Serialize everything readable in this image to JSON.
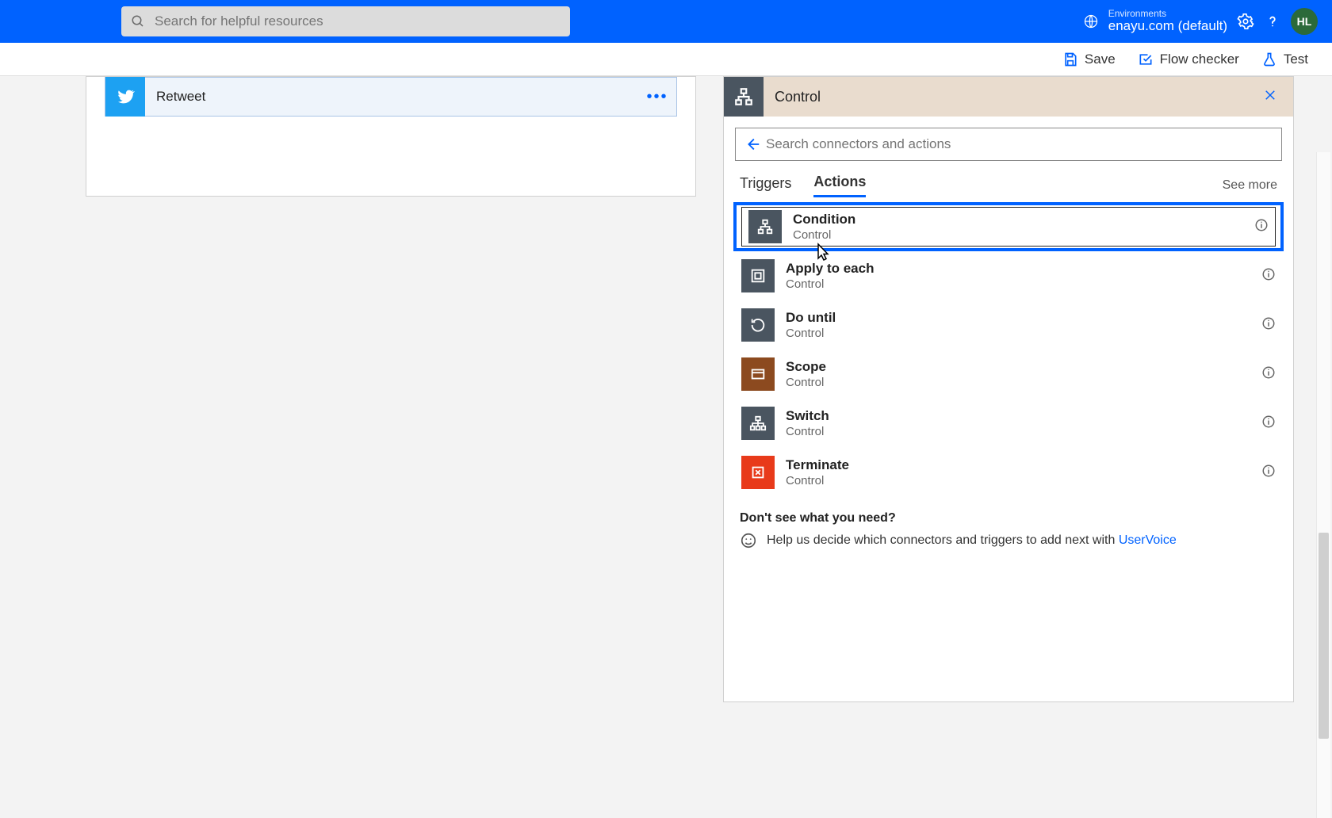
{
  "header": {
    "search_placeholder": "Search for helpful resources",
    "env_label": "Environments",
    "env_name": "enayu.com (default)",
    "avatar": "HL"
  },
  "toolbar": {
    "save": "Save",
    "flow_checker": "Flow checker",
    "test": "Test"
  },
  "left": {
    "card_title": "Retweet"
  },
  "panel": {
    "title": "Control",
    "search_placeholder": "Search connectors and actions",
    "tabs": {
      "triggers": "Triggers",
      "actions": "Actions",
      "see_more": "See more"
    },
    "actions": [
      {
        "name": "Condition",
        "connector": "Control",
        "icon": "dark"
      },
      {
        "name": "Apply to each",
        "connector": "Control",
        "icon": "dark"
      },
      {
        "name": "Do until",
        "connector": "Control",
        "icon": "dark"
      },
      {
        "name": "Scope",
        "connector": "Control",
        "icon": "brown"
      },
      {
        "name": "Switch",
        "connector": "Control",
        "icon": "dark"
      },
      {
        "name": "Terminate",
        "connector": "Control",
        "icon": "red"
      }
    ],
    "footer": {
      "heading": "Don't see what you need?",
      "help_prefix": "Help us decide which connectors and triggers to add next with ",
      "help_link": "UserVoice"
    }
  }
}
